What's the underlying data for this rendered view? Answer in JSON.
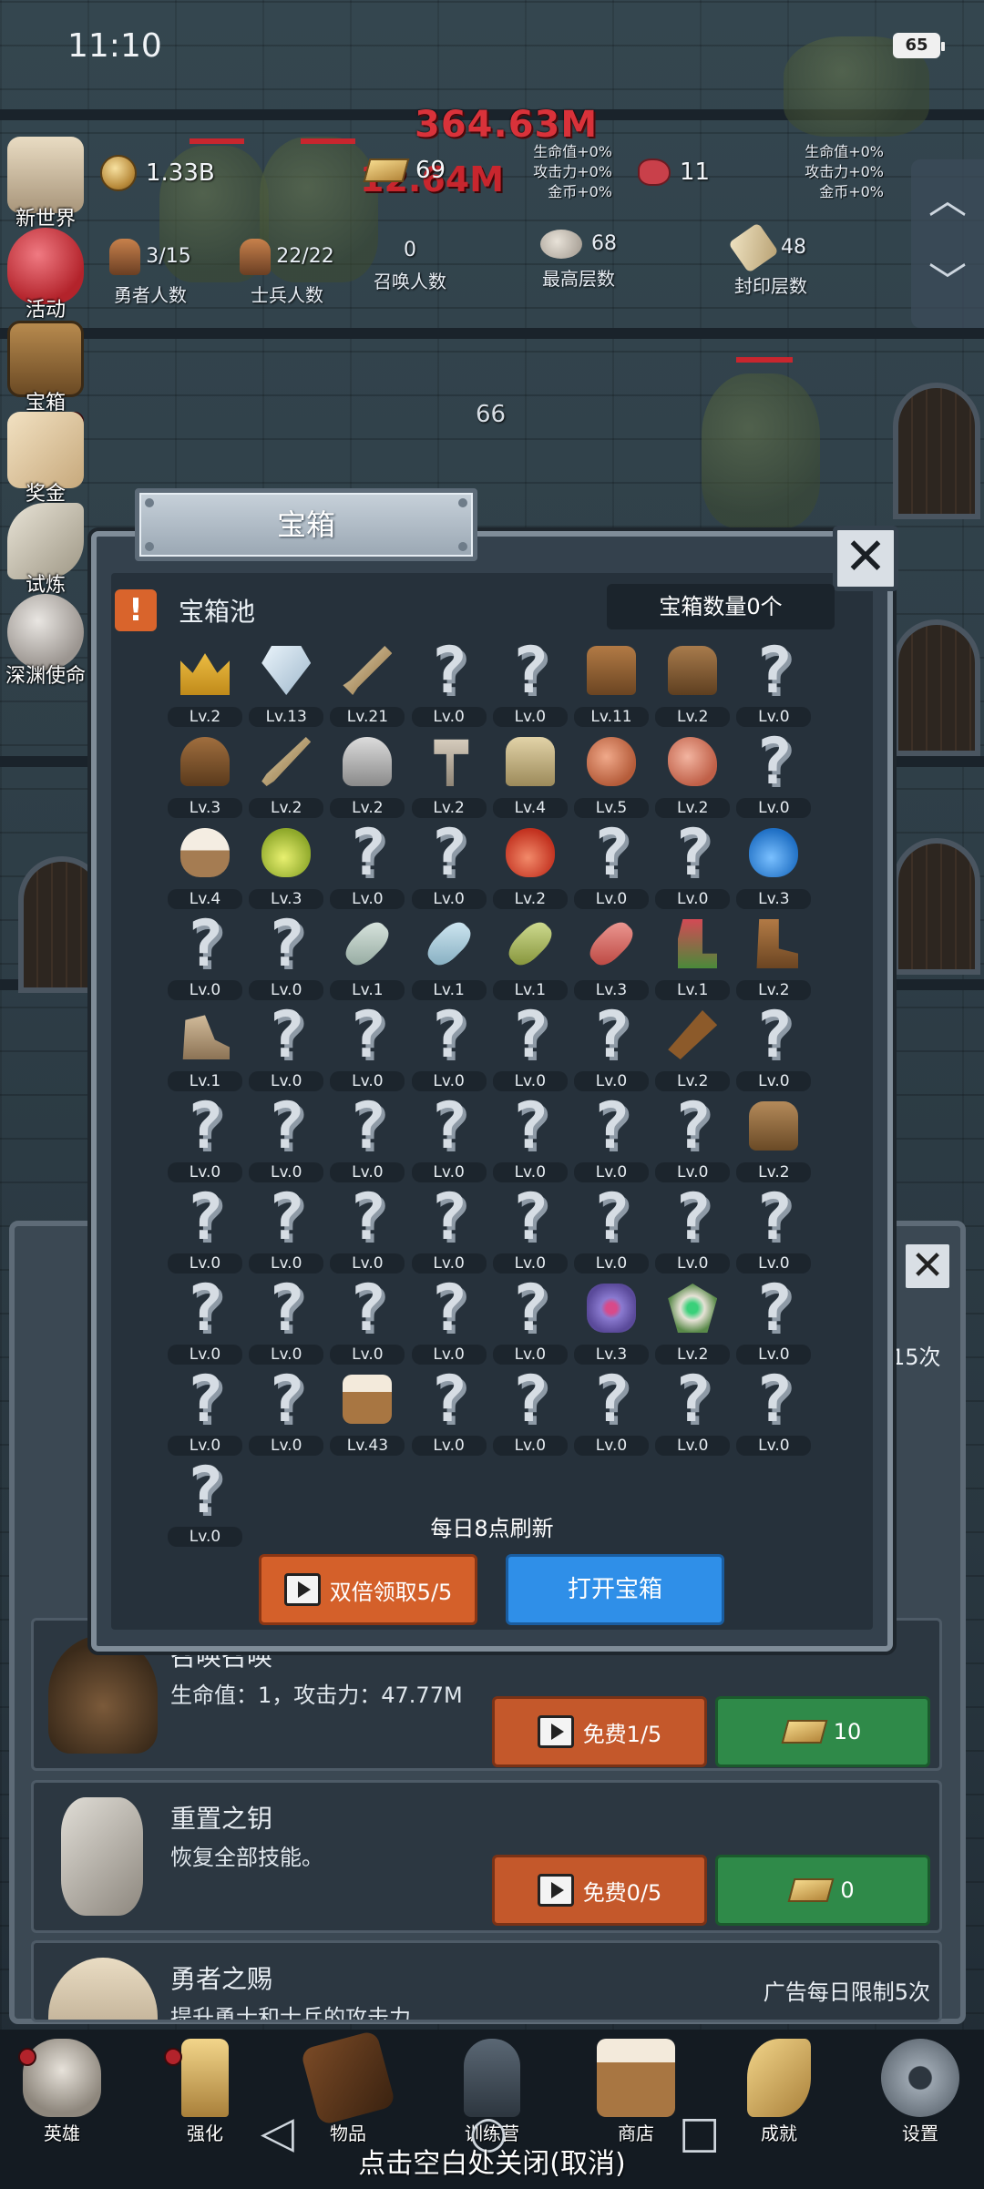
{
  "status_bar": {
    "time": "11:10",
    "battery": "65"
  },
  "battle": {
    "damage_top": "364.63M",
    "damage_mid": "12.64M",
    "floor_number": "66"
  },
  "header_stats": {
    "coins": "1.33B",
    "gold_bars": "69",
    "meat": "11",
    "bonus_left": [
      "生命值+0%",
      "攻击力+0%",
      "金币+0%"
    ],
    "bonus_right": [
      "生命值+0%",
      "攻击力+0%",
      "金币+0%"
    ],
    "hero_count": {
      "value": "3/15",
      "label": "勇者人数"
    },
    "soldier_count": {
      "value": "22/22",
      "label": "士兵人数"
    },
    "summon_count": {
      "value": "0",
      "label": "召唤人数"
    },
    "max_floor": {
      "value": "68",
      "label": "最高层数"
    },
    "seal_floor": {
      "value": "48",
      "label": "封印层数"
    }
  },
  "left_menu": [
    "新世界",
    "活动",
    "宝箱",
    "奖金",
    "试炼",
    "深渊使命"
  ],
  "modal": {
    "title": "宝箱",
    "pool_label": "宝箱池",
    "count_label": "宝箱数量0个",
    "refresh_note": "每日8点刷新",
    "double_button": "双倍领取5/5",
    "open_button": "打开宝箱",
    "items": [
      {
        "icon": "crown",
        "lv": "Lv.2"
      },
      {
        "icon": "diamond",
        "lv": "Lv.13"
      },
      {
        "icon": "sword",
        "lv": "Lv.21"
      },
      {
        "icon": "unknown",
        "lv": "Lv.0"
      },
      {
        "icon": "unknown",
        "lv": "Lv.0"
      },
      {
        "icon": "leather-armor",
        "lv": "Lv.11"
      },
      {
        "icon": "backpack",
        "lv": "Lv.2"
      },
      {
        "icon": "unknown",
        "lv": "Lv.0"
      },
      {
        "icon": "leather-helmet",
        "lv": "Lv.3"
      },
      {
        "icon": "dagger",
        "lv": "Lv.2"
      },
      {
        "icon": "knight-helmet",
        "lv": "Lv.2"
      },
      {
        "icon": "hammer",
        "lv": "Lv.2"
      },
      {
        "icon": "great-helmet",
        "lv": "Lv.4"
      },
      {
        "icon": "ham",
        "lv": "Lv.5"
      },
      {
        "icon": "steak",
        "lv": "Lv.2"
      },
      {
        "icon": "unknown",
        "lv": "Lv.0"
      },
      {
        "icon": "flour-bowl",
        "lv": "Lv.4"
      },
      {
        "icon": "yellow-potion",
        "lv": "Lv.3"
      },
      {
        "icon": "unknown",
        "lv": "Lv.0"
      },
      {
        "icon": "unknown",
        "lv": "Lv.0"
      },
      {
        "icon": "red-potion",
        "lv": "Lv.2"
      },
      {
        "icon": "unknown",
        "lv": "Lv.0"
      },
      {
        "icon": "unknown",
        "lv": "Lv.0"
      },
      {
        "icon": "blue-potion",
        "lv": "Lv.3"
      },
      {
        "icon": "unknown",
        "lv": "Lv.0"
      },
      {
        "icon": "unknown",
        "lv": "Lv.0"
      },
      {
        "icon": "empty-bottle",
        "lv": "Lv.1"
      },
      {
        "icon": "blue-bottle",
        "lv": "Lv.1"
      },
      {
        "icon": "green-bottle",
        "lv": "Lv.1"
      },
      {
        "icon": "red-bottle",
        "lv": "Lv.3"
      },
      {
        "icon": "winged-boot",
        "lv": "Lv.1"
      },
      {
        "icon": "leather-boot",
        "lv": "Lv.2"
      },
      {
        "icon": "shoe",
        "lv": "Lv.1"
      },
      {
        "icon": "unknown",
        "lv": "Lv.0"
      },
      {
        "icon": "unknown",
        "lv": "Lv.0"
      },
      {
        "icon": "unknown",
        "lv": "Lv.0"
      },
      {
        "icon": "unknown",
        "lv": "Lv.0"
      },
      {
        "icon": "unknown",
        "lv": "Lv.0"
      },
      {
        "icon": "torch",
        "lv": "Lv.2"
      },
      {
        "icon": "unknown",
        "lv": "Lv.0"
      },
      {
        "icon": "unknown",
        "lv": "Lv.0"
      },
      {
        "icon": "unknown",
        "lv": "Lv.0"
      },
      {
        "icon": "unknown",
        "lv": "Lv.0"
      },
      {
        "icon": "unknown",
        "lv": "Lv.0"
      },
      {
        "icon": "unknown",
        "lv": "Lv.0"
      },
      {
        "icon": "unknown",
        "lv": "Lv.0"
      },
      {
        "icon": "unknown",
        "lv": "Lv.0"
      },
      {
        "icon": "satchel",
        "lv": "Lv.2"
      },
      {
        "icon": "unknown",
        "lv": "Lv.0"
      },
      {
        "icon": "unknown",
        "lv": "Lv.0"
      },
      {
        "icon": "unknown",
        "lv": "Lv.0"
      },
      {
        "icon": "unknown",
        "lv": "Lv.0"
      },
      {
        "icon": "unknown",
        "lv": "Lv.0"
      },
      {
        "icon": "unknown",
        "lv": "Lv.0"
      },
      {
        "icon": "unknown",
        "lv": "Lv.0"
      },
      {
        "icon": "unknown",
        "lv": "Lv.0"
      },
      {
        "icon": "unknown",
        "lv": "Lv.0"
      },
      {
        "icon": "unknown",
        "lv": "Lv.0"
      },
      {
        "icon": "unknown",
        "lv": "Lv.0"
      },
      {
        "icon": "unknown",
        "lv": "Lv.0"
      },
      {
        "icon": "unknown",
        "lv": "Lv.0"
      },
      {
        "icon": "orb-relic",
        "lv": "Lv.3"
      },
      {
        "icon": "eye-amulet",
        "lv": "Lv.2"
      },
      {
        "icon": "unknown",
        "lv": "Lv.0"
      },
      {
        "icon": "unknown",
        "lv": "Lv.0"
      },
      {
        "icon": "unknown",
        "lv": "Lv.0"
      },
      {
        "icon": "beer-mug",
        "lv": "Lv.43"
      },
      {
        "icon": "unknown",
        "lv": "Lv.0"
      },
      {
        "icon": "unknown",
        "lv": "Lv.0"
      },
      {
        "icon": "unknown",
        "lv": "Lv.0"
      },
      {
        "icon": "unknown",
        "lv": "Lv.0"
      },
      {
        "icon": "unknown",
        "lv": "Lv.0"
      },
      {
        "icon": "unknown",
        "lv": "Lv.0"
      }
    ]
  },
  "under_panel": {
    "partial_limit_top": "15次",
    "row1": {
      "title": "召唤召唤",
      "desc": "生命值：1，攻击力：47.77M",
      "free_btn": "免费1/5",
      "gold_btn": "10"
    },
    "row2": {
      "title": "重置之钥",
      "desc": "恢复全部技能。",
      "free_btn": "免费0/5",
      "gold_btn": "0"
    },
    "row3": {
      "title": "勇者之赐",
      "desc": "提升勇士和士兵的攻击力。",
      "limit": "广告每日限制5次"
    }
  },
  "bottom_nav": [
    "英雄",
    "强化",
    "物品",
    "训练营",
    "商店",
    "成就",
    "设置"
  ],
  "close_hint": "点击空白处关闭(取消)",
  "colors": {
    "accent_orange": "#d4602a",
    "accent_blue": "#2f8fe8",
    "accent_green": "#2f8a49",
    "damage_red": "#d9323a"
  }
}
